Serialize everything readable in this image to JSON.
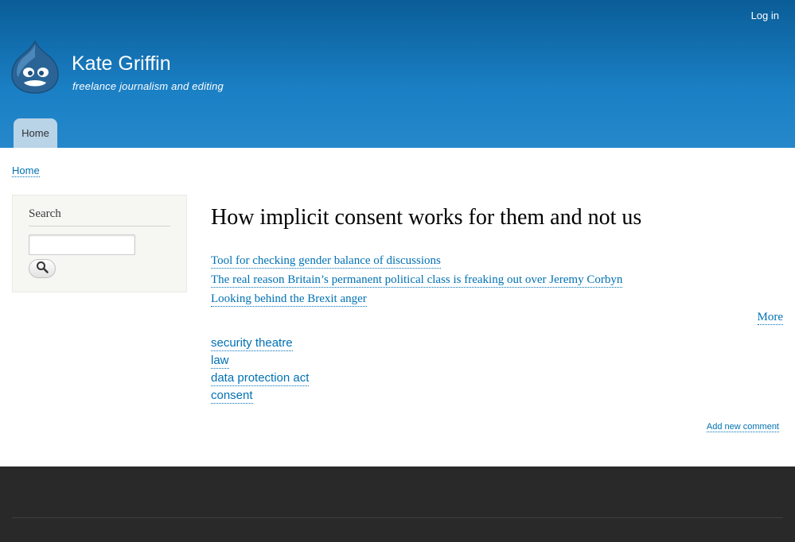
{
  "header": {
    "login_label": "Log in",
    "site_name": "Kate Griffin",
    "site_slogan": "freelance journalism and editing",
    "menu": [
      {
        "label": "Home"
      }
    ],
    "logo_icon": "drupal-drop-icon"
  },
  "breadcrumb": {
    "items": [
      {
        "label": "Home"
      }
    ]
  },
  "sidebar": {
    "search_title": "Search",
    "search_value": "",
    "search_button_icon": "search-icon"
  },
  "main": {
    "title": "How implicit consent works for them and not us",
    "related": [
      {
        "label": "Tool for checking gender balance of discussions"
      },
      {
        "label": "The real reason Britain’s permanent political class is freaking out over Jeremy Corbyn"
      },
      {
        "label": "Looking behind the Brexit anger"
      }
    ],
    "more_label": "More",
    "tags": [
      {
        "label": "security theatre"
      },
      {
        "label": "law"
      },
      {
        "label": "data protection act"
      },
      {
        "label": "consent"
      }
    ],
    "add_comment_label": "Add new comment"
  },
  "colors": {
    "header_top": "#0a5d97",
    "header_bottom": "#2588cb",
    "link": "#0071b3",
    "footer": "#292929"
  }
}
